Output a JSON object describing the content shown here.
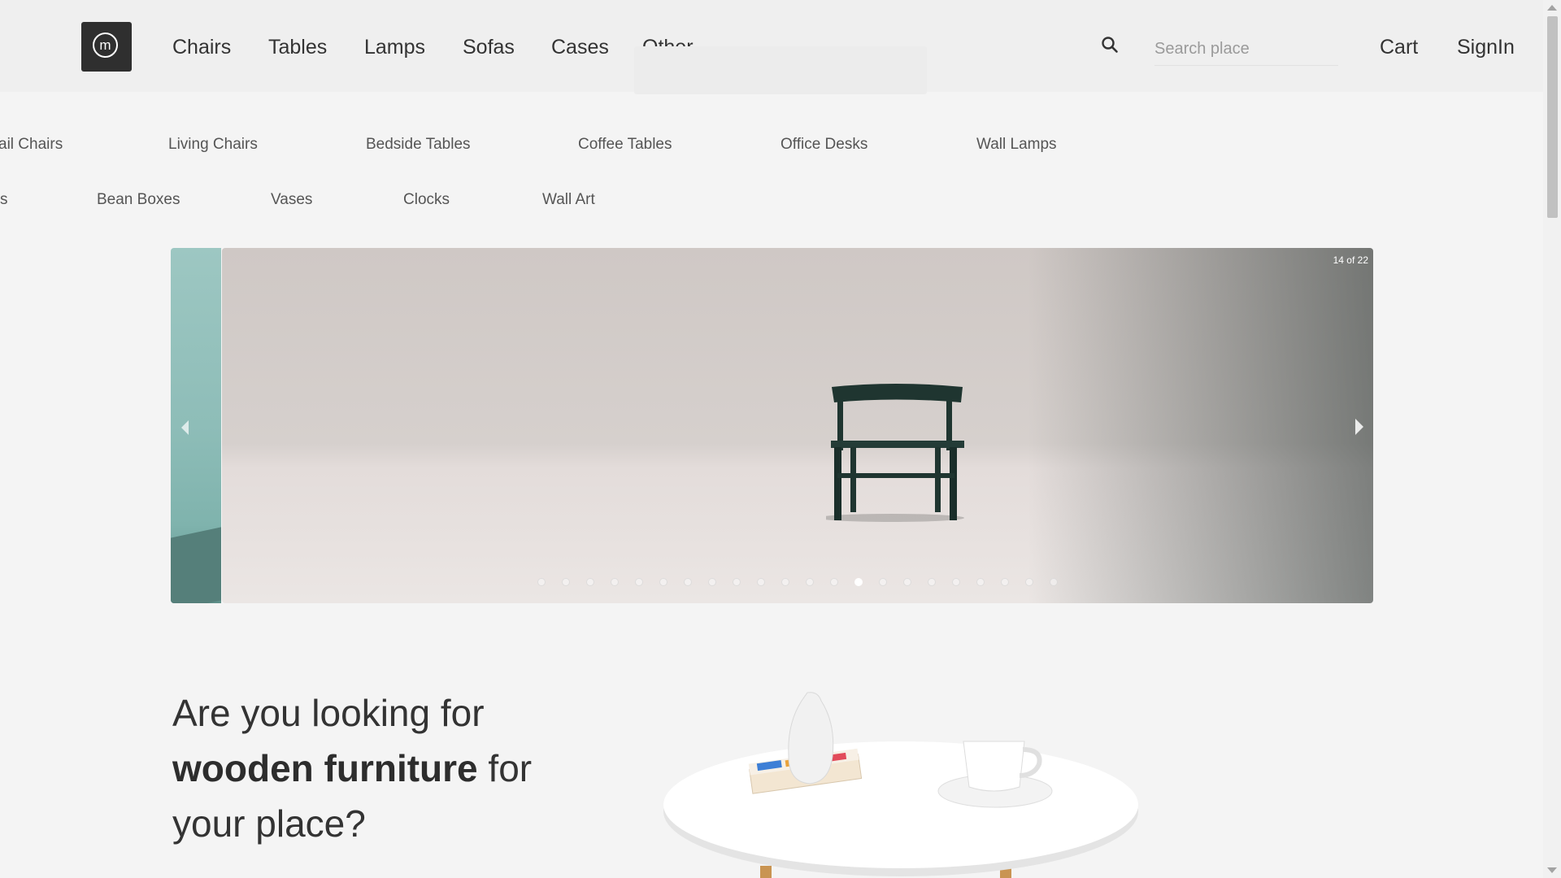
{
  "nav": {
    "logo_letter": "m",
    "items": [
      {
        "label": "Chairs"
      },
      {
        "label": "Tables"
      },
      {
        "label": "Lamps"
      },
      {
        "label": "Sofas"
      },
      {
        "label": "Cases"
      },
      {
        "label": "Other"
      }
    ]
  },
  "search": {
    "placeholder": "Search place",
    "value": ""
  },
  "header_links": {
    "cart": "Cart",
    "signin": "SignIn"
  },
  "subcategories": {
    "row1": [
      "ail Chairs",
      "Living Chairs",
      "Bedside Tables",
      "Coffee Tables",
      "Office Desks",
      "Wall Lamps"
    ],
    "row2": [
      "s",
      "Bean Boxes",
      "Vases",
      "Clocks",
      "Wall Art"
    ]
  },
  "carousel": {
    "counter": "14 of 22",
    "current": 14,
    "total": 22
  },
  "hero": {
    "line1": "Are you looking for",
    "bold": "wooden furniture",
    "after_bold": " for",
    "line3": "your place?"
  },
  "colors": {
    "background": "#f4f4f4",
    "logo_bg": "#2f2f2f",
    "text": "#333333",
    "chair": "#1f3530"
  }
}
